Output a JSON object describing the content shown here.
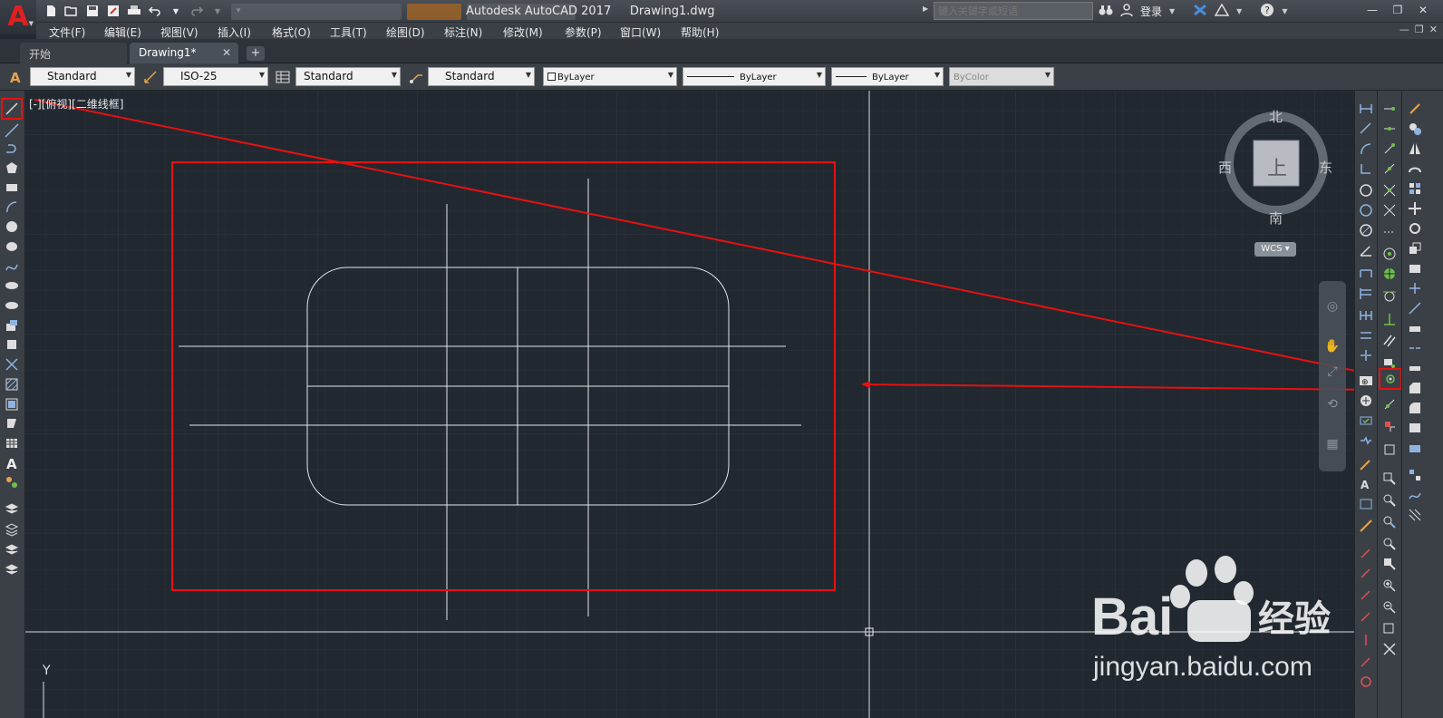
{
  "app": {
    "title": "Autodesk AutoCAD 2017",
    "filename": "Drawing1.dwg",
    "logo_letter": "A"
  },
  "search": {
    "placeholder": "键入关键字或短语"
  },
  "account": {
    "login_label": "登录"
  },
  "menu": {
    "items": [
      "文件(F)",
      "编辑(E)",
      "视图(V)",
      "插入(I)",
      "格式(O)",
      "工具(T)",
      "绘图(D)",
      "标注(N)",
      "修改(M)",
      "参数(P)",
      "窗口(W)",
      "帮助(H)"
    ]
  },
  "tabs": {
    "start_label": "开始",
    "active_label": "Drawing1*"
  },
  "styles_toolbar": {
    "text_style": "Standard",
    "dim_style": "ISO-25",
    "table_style": "Standard",
    "mleader_style": "Standard",
    "color": "ByLayer",
    "linetype": "ByLayer",
    "lineweight": "ByLayer",
    "plot_style": "ByColor"
  },
  "viewport": {
    "label": "[-][俯视][二维线框]"
  },
  "viewcube": {
    "face": "上",
    "north": "北",
    "south": "南",
    "east": "东",
    "west": "西",
    "wcs_label": "WCS"
  },
  "ucs": {
    "y_label": "Y"
  },
  "watermark": {
    "brand": "Bai",
    "brand_cn": "经验",
    "url": "jingyan.baidu.com"
  },
  "colors": {
    "canvas": "#212830",
    "grid": "#2b323b",
    "annotation_red": "#e81010",
    "geometry": "#e6e6e6",
    "accent": "#e02020"
  },
  "icons": {
    "left_toolbar": [
      "line-icon",
      "construction-line-icon",
      "polyline-icon",
      "polygon-icon",
      "rectangle-icon",
      "arc-icon",
      "circle-icon",
      "revision-cloud-icon",
      "spline-icon",
      "ellipse-icon",
      "ellipse-arc-icon",
      "insert-block-icon",
      "make-block-icon",
      "point-icon",
      "hatch-icon",
      "gradient-icon",
      "region-icon",
      "table-icon",
      "multiline-text-icon",
      "add-selected-icon",
      "layer-icon",
      "layer-states-icon",
      "layer-walk-icon",
      "layer-match-icon"
    ]
  }
}
